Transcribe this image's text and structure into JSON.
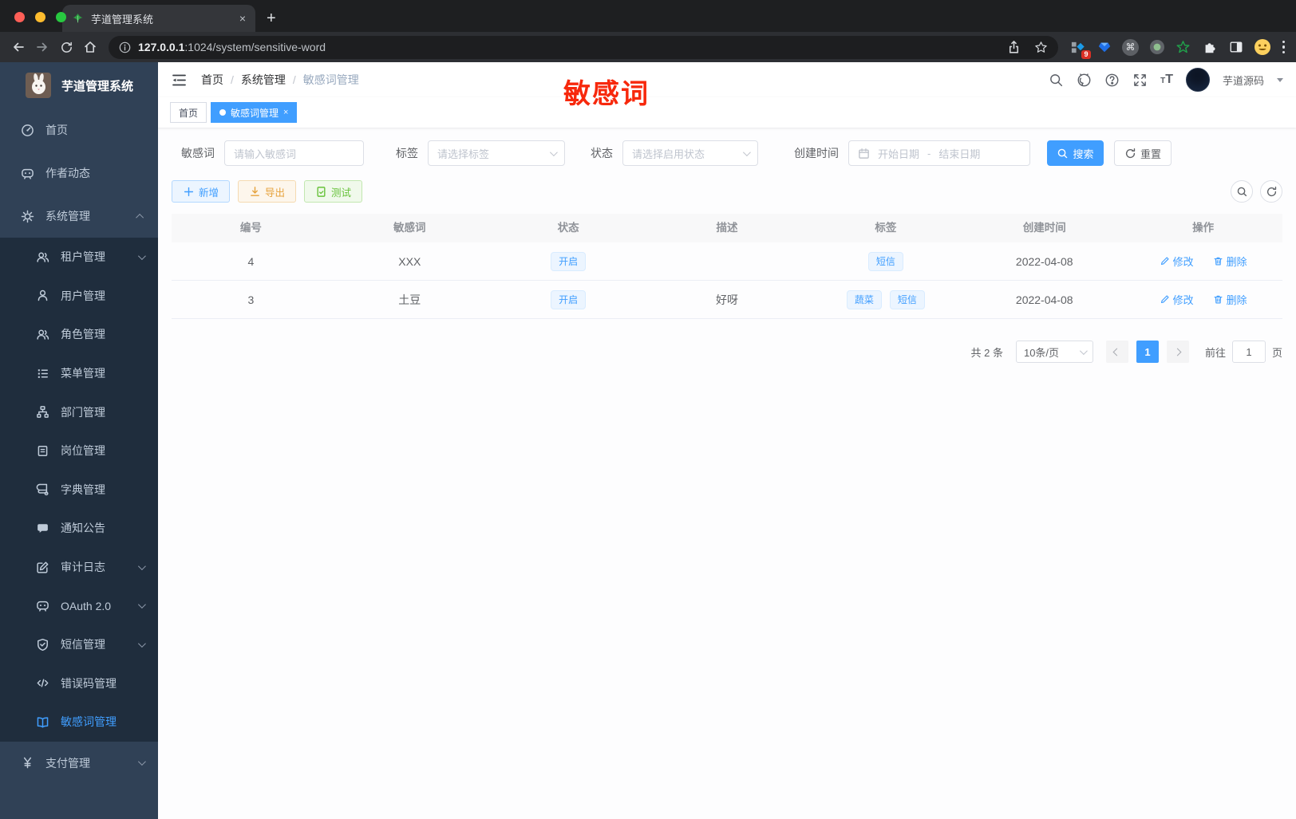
{
  "colors": {
    "primary": "#409eff",
    "warning": "#e6a23c",
    "success": "#67c23a",
    "annotation_red": "#f7280c",
    "sidebar_bg": "#304156",
    "submenu_bg": "#1f2d3d"
  },
  "browser": {
    "tab_title": "芋道管理系统",
    "close_glyph": "×",
    "new_tab_glyph": "+",
    "url_host": "127.0.0.1",
    "url_rest": ":1024/system/sensitive-word",
    "extension_badge": "9",
    "command_glyph": "⌘"
  },
  "sidebar": {
    "title": "芋道管理系统",
    "top_items": [
      {
        "label": "首页"
      },
      {
        "label": "作者动态"
      }
    ],
    "system": {
      "label": "系统管理"
    },
    "sub_items": [
      {
        "label": "租户管理"
      },
      {
        "label": "用户管理"
      },
      {
        "label": "角色管理"
      },
      {
        "label": "菜单管理"
      },
      {
        "label": "部门管理"
      },
      {
        "label": "岗位管理"
      },
      {
        "label": "字典管理"
      },
      {
        "label": "通知公告"
      },
      {
        "label": "审计日志"
      },
      {
        "label": "OAuth 2.0"
      },
      {
        "label": "短信管理"
      },
      {
        "label": "错误码管理"
      },
      {
        "label": "敏感词管理"
      }
    ],
    "bottom_items": [
      {
        "label": "支付管理"
      }
    ]
  },
  "header": {
    "breadcrumb": [
      "首页",
      "系统管理",
      "敏感词管理"
    ],
    "separator": "/",
    "t_small": "T",
    "t_big": "T",
    "user_name": "芋道源码"
  },
  "tagsbar": {
    "home": "首页",
    "active": "敏感词管理",
    "close": "×"
  },
  "annotation": {
    "text": "敏感词"
  },
  "filters": {
    "keyword_label": "敏感词",
    "keyword_placeholder": "请输入敏感词",
    "tag_label": "标签",
    "tag_placeholder": "请选择标签",
    "status_label": "状态",
    "status_placeholder": "请选择启用状态",
    "date_label": "创建时间",
    "date_start": "开始日期",
    "date_sep": "-",
    "date_end": "结束日期",
    "search": "搜索",
    "reset": "重置"
  },
  "toolbar": {
    "add": "新增",
    "export": "导出",
    "test": "测试"
  },
  "table": {
    "headers": [
      "编号",
      "敏感词",
      "状态",
      "描述",
      "标签",
      "创建时间",
      "操作"
    ],
    "rows": [
      {
        "id": "4",
        "word": "XXX",
        "status": "开启",
        "desc": "",
        "tags": [
          "短信"
        ],
        "created": "2022-04-08",
        "edit": "修改",
        "delete": "删除"
      },
      {
        "id": "3",
        "word": "土豆",
        "status": "开启",
        "desc": "好呀",
        "tags": [
          "蔬菜",
          "短信"
        ],
        "created": "2022-04-08",
        "edit": "修改",
        "delete": "删除"
      }
    ]
  },
  "pagination": {
    "total": "共 2 条",
    "size": "10条/页",
    "page": "1",
    "goto": "前往",
    "goto_value": "1",
    "unit": "页"
  }
}
